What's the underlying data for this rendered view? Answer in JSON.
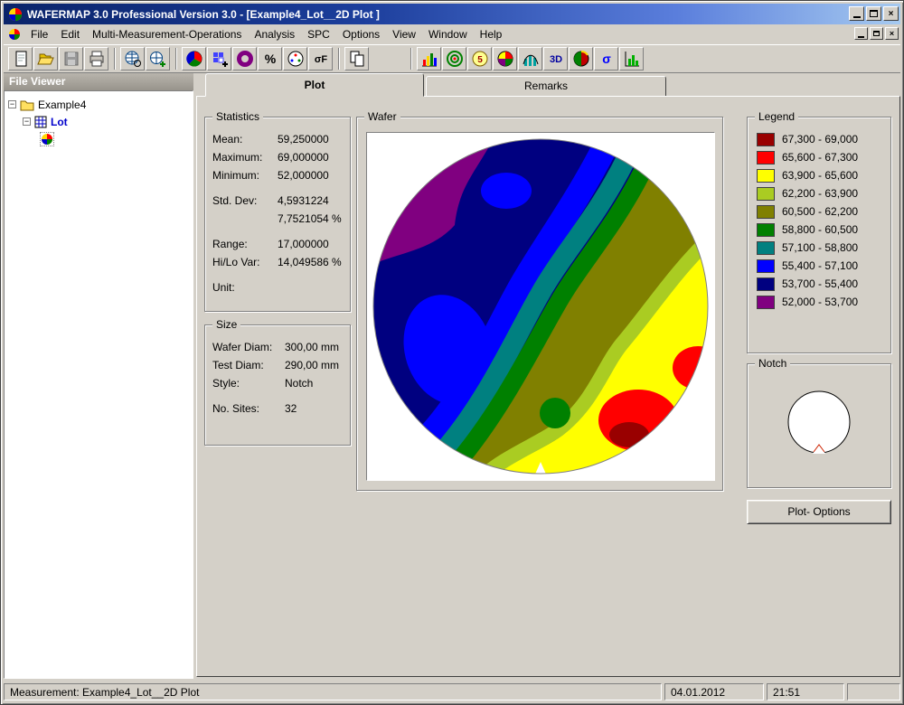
{
  "window": {
    "title": "WAFERMAP 3.0  Professional Version 3.0 - [Example4_Lot__2D Plot ]"
  },
  "menu": {
    "items": [
      "File",
      "Edit",
      "Multi-Measurement-Operations",
      "Analysis",
      "SPC",
      "Options",
      "View",
      "Window",
      "Help"
    ]
  },
  "toolbar": {
    "buttons": [
      "new",
      "open",
      "save",
      "print",
      "wafer-select",
      "wafer-add",
      "color-wafer",
      "die-add",
      "donut-chart",
      "percent",
      "sites",
      "sigma-f",
      "copy",
      "histogram",
      "target",
      "spc-circle",
      "pie-chart",
      "distribution",
      "3d-view",
      "sphere",
      "sigma",
      "bar-chart"
    ],
    "glyphs": {
      "percent": "%",
      "sigma_f": "σF",
      "spc5": "5",
      "three_d": "3D",
      "sigma": "σ"
    }
  },
  "file_viewer": {
    "title": "File Viewer",
    "tree": {
      "root": "Example4",
      "child": "Lot"
    }
  },
  "tabs": {
    "plot": "Plot",
    "remarks": "Remarks"
  },
  "statistics": {
    "title": "Statistics",
    "rows": [
      {
        "label": "Mean:",
        "value": "59,250000"
      },
      {
        "label": "Maximum:",
        "value": "69,000000"
      },
      {
        "label": "Minimum:",
        "value": "52,000000"
      },
      {
        "label": "Std. Dev:",
        "value": "4,5931224"
      },
      {
        "label": "",
        "value": "7,7521054 %"
      },
      {
        "label": "Range:",
        "value": "17,000000"
      },
      {
        "label": "Hi/Lo Var:",
        "value": "14,049586 %"
      },
      {
        "label": "Unit:",
        "value": ""
      }
    ]
  },
  "size": {
    "title": "Size",
    "rows": [
      {
        "label": "Wafer Diam:",
        "value": "300,00 mm"
      },
      {
        "label": "Test Diam:",
        "value": "290,00 mm"
      },
      {
        "label": "Style:",
        "value": "Notch"
      },
      {
        "label": "No. Sites:",
        "value": "32"
      }
    ]
  },
  "wafer": {
    "title": "Wafer"
  },
  "legend": {
    "title": "Legend",
    "entries": [
      {
        "range": "67,300 - 69,000",
        "color": "#990000"
      },
      {
        "range": "65,600 - 67,300",
        "color": "#FF0000"
      },
      {
        "range": "63,900 - 65,600",
        "color": "#FFFF00"
      },
      {
        "range": "62,200 - 63,900",
        "color": "#AACC22"
      },
      {
        "range": "60,500 - 62,200",
        "color": "#808000"
      },
      {
        "range": "58,800 - 60,500",
        "color": "#008000"
      },
      {
        "range": "57,100 - 58,800",
        "color": "#008080"
      },
      {
        "range": "55,400 - 57,100",
        "color": "#0000FF"
      },
      {
        "range": "53,700 - 55,400",
        "color": "#000080"
      },
      {
        "range": "52,000 - 53,700",
        "color": "#800080"
      }
    ]
  },
  "notch": {
    "title": "Notch"
  },
  "plot_options": {
    "label": "Plot- Options"
  },
  "status": {
    "measurement": "Measurement: Example4_Lot__2D Plot",
    "date": "04.01.2012",
    "time": "21:51"
  }
}
